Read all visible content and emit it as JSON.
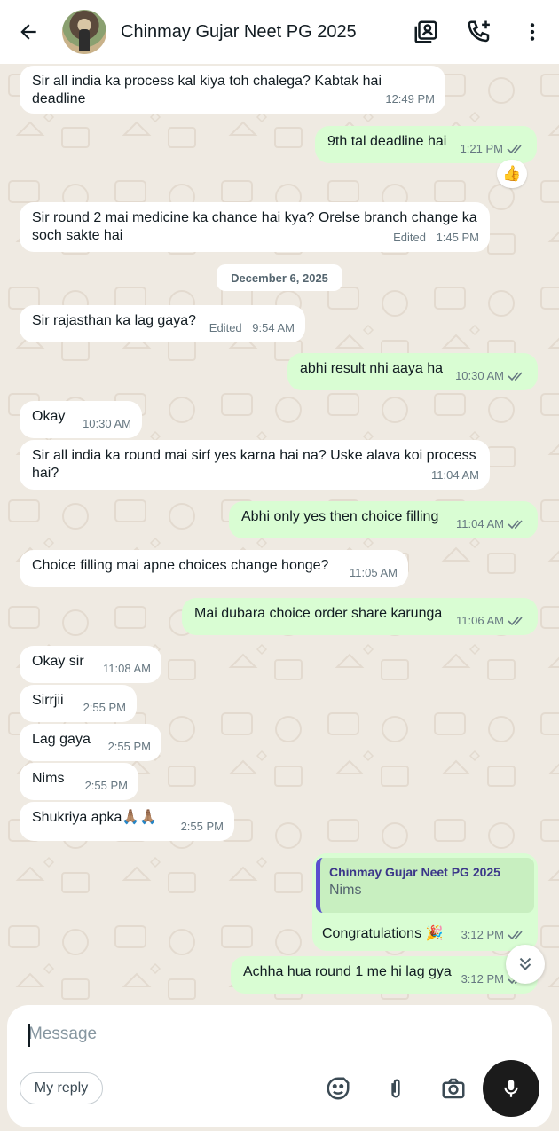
{
  "header": {
    "title": "Chinmay Gujar Neet PG 2025",
    "back_icon": "arrow-left-icon",
    "icons": [
      "contact-card-icon",
      "add-call-icon",
      "more-vertical-icon"
    ]
  },
  "date_separator": "December 6, 2025",
  "messages": [
    {
      "dir": "in",
      "text": "Sir all india ka process kal kiya toh chalega? Kabtak hai deadline",
      "time": "12:49 PM"
    },
    {
      "dir": "out",
      "text": "9th tal deadline hai",
      "time": "1:21 PM",
      "reaction": "👍"
    },
    {
      "dir": "in",
      "text": "Sir round 2 mai medicine ka chance hai kya? Orelse branch change ka soch sakte hai",
      "time": "1:45 PM",
      "edited": "Edited"
    },
    {
      "dir": "in",
      "text": "Sir rajasthan ka lag gaya?",
      "time": "9:54 AM",
      "edited": "Edited"
    },
    {
      "dir": "out",
      "text": "abhi result nhi aaya ha",
      "time": "10:30 AM"
    },
    {
      "dir": "in",
      "text": "Okay",
      "time": "10:30 AM"
    },
    {
      "dir": "in",
      "text": "Sir all india ka round mai sirf yes karna hai na? Uske alava koi process hai?",
      "time": "11:04 AM"
    },
    {
      "dir": "out",
      "text": "Abhi only yes then choice filling",
      "time": "11:04 AM"
    },
    {
      "dir": "in",
      "text": "Choice filling mai apne choices change honge?",
      "time": "11:05 AM"
    },
    {
      "dir": "out",
      "text": "Mai dubara choice order share karunga",
      "time": "11:06 AM"
    },
    {
      "dir": "in",
      "text": "Okay sir",
      "time": "11:08 AM"
    },
    {
      "dir": "in",
      "text": "Sirrjii",
      "time": "2:55 PM"
    },
    {
      "dir": "in",
      "text": "Lag gaya",
      "time": "2:55 PM"
    },
    {
      "dir": "in",
      "text": "Nims",
      "time": "2:55 PM"
    },
    {
      "dir": "in",
      "text": "Shukriya apka🙏🏽🙏🏽",
      "time": "2:55 PM"
    },
    {
      "dir": "out",
      "text": "Congratulations 🎉",
      "time": "3:12 PM",
      "quote": {
        "name": "Chinmay Gujar Neet PG 2025",
        "text": "Nims"
      }
    },
    {
      "dir": "out",
      "text": "Achha hua round 1 me hi lag gya",
      "time": "3:12 PM"
    }
  ],
  "composer": {
    "placeholder": "Message",
    "my_reply": "My reply",
    "icons": [
      "sticker-icon",
      "attach-icon",
      "camera-icon",
      "mic-icon"
    ]
  },
  "colors": {
    "incoming_bubble": "#ffffff",
    "outgoing_bubble": "#d9fdd3",
    "chat_background": "#efeae2",
    "read_ticks": "#667781",
    "quote_bar": "#5a4fcf"
  }
}
